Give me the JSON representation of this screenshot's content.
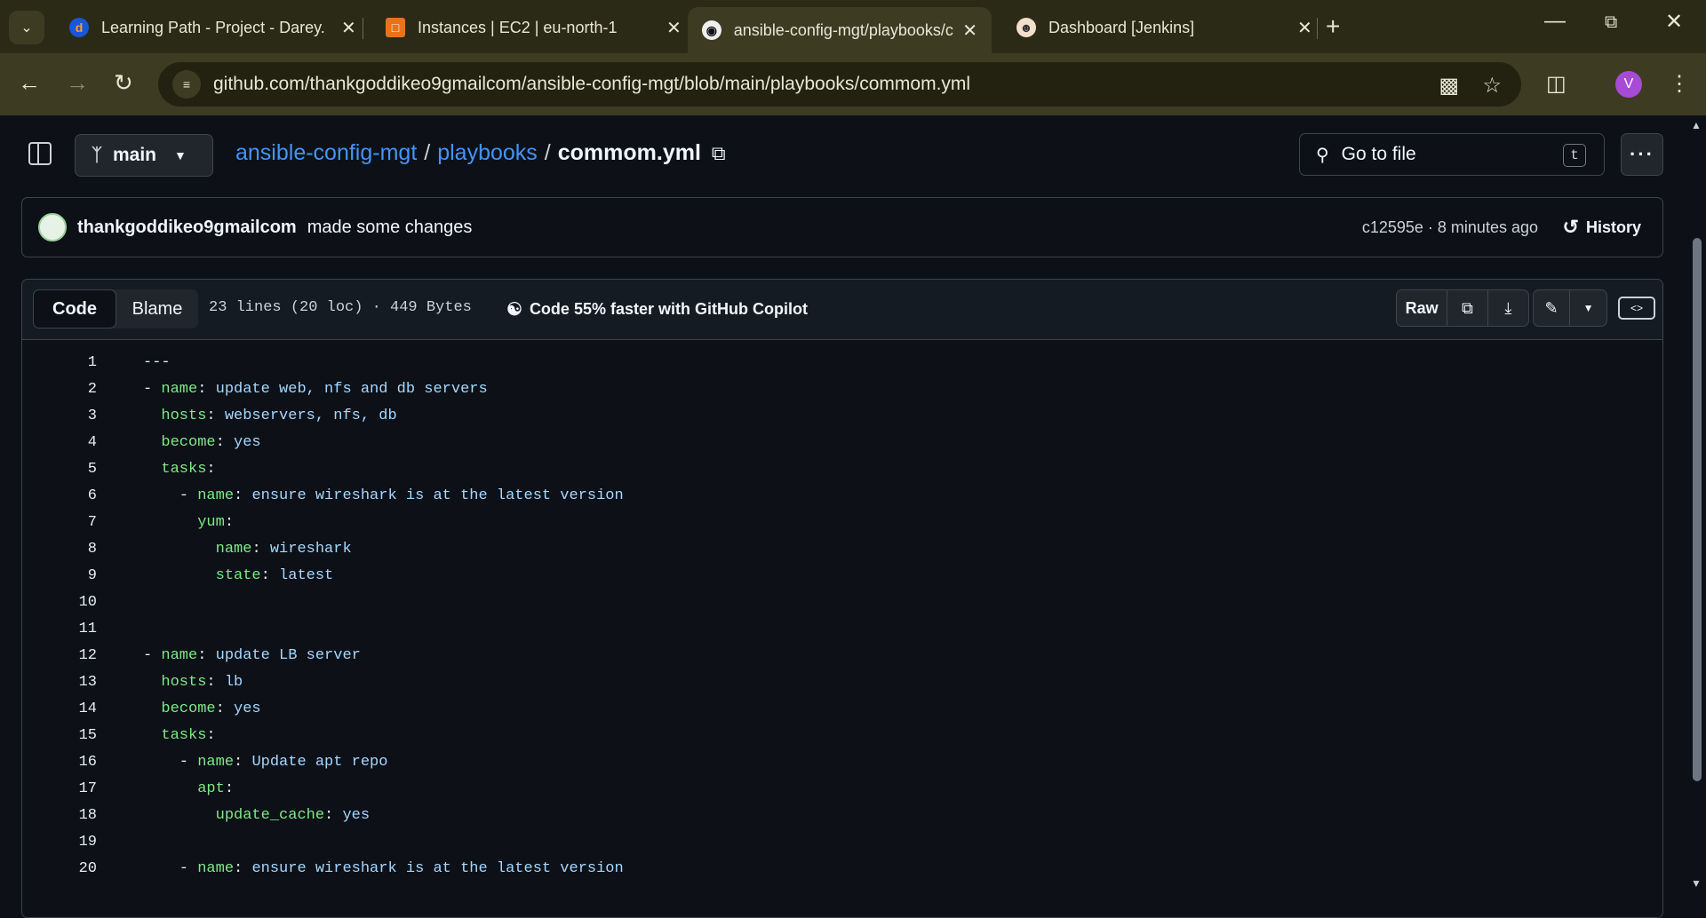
{
  "browser": {
    "tabs": [
      {
        "title": "Learning Path - Project - Darey.",
        "favicon": "darey-icon",
        "active": false
      },
      {
        "title": "Instances | EC2 | eu-north-1",
        "favicon": "aws-icon",
        "active": false
      },
      {
        "title": "ansible-config-mgt/playbooks/c",
        "favicon": "github-icon",
        "active": true
      },
      {
        "title": "Dashboard [Jenkins]",
        "favicon": "jenkins-icon",
        "active": false
      }
    ],
    "url": "github.com/thankgoddikeo9gmailcom/ansible-config-mgt/blob/main/playbooks/commom.yml",
    "profile_initial": "V"
  },
  "repo": {
    "branch": "main",
    "repo_name": "ansible-config-mgt",
    "folder": "playbooks",
    "file": "commom.yml",
    "goto_placeholder": "Go to file",
    "goto_shortcut": "t"
  },
  "commit": {
    "author": "thankgoddikeo9gmailcom",
    "message": "made some changes",
    "meta": "c12595e · 8 minutes ago",
    "history_label": "History"
  },
  "code_toolbar": {
    "code_tab": "Code",
    "blame_tab": "Blame",
    "lines_info": "23 lines (20 loc) · 449 Bytes",
    "copilot_label": "Code 55% faster with GitHub Copilot",
    "raw_label": "Raw"
  },
  "code_lines": [
    {
      "n": "1",
      "indent": "",
      "key": "",
      "value": "---"
    },
    {
      "n": "2",
      "indent": "- ",
      "key": "name",
      "value": "update web, nfs and db servers"
    },
    {
      "n": "3",
      "indent": "  ",
      "key": "hosts",
      "value": "webservers, nfs, db"
    },
    {
      "n": "4",
      "indent": "  ",
      "key": "become",
      "value": "yes"
    },
    {
      "n": "5",
      "indent": "  ",
      "key": "tasks",
      "value": ""
    },
    {
      "n": "6",
      "indent": "    - ",
      "key": "name",
      "value": "ensure wireshark is at the latest version"
    },
    {
      "n": "7",
      "indent": "      ",
      "key": "yum",
      "value": ""
    },
    {
      "n": "8",
      "indent": "        ",
      "key": "name",
      "value": "wireshark"
    },
    {
      "n": "9",
      "indent": "        ",
      "key": "state",
      "value": "latest"
    },
    {
      "n": "10",
      "indent": "",
      "key": "",
      "value": ""
    },
    {
      "n": "11",
      "indent": "",
      "key": "",
      "value": ""
    },
    {
      "n": "12",
      "indent": "- ",
      "key": "name",
      "value": "update LB server"
    },
    {
      "n": "13",
      "indent": "  ",
      "key": "hosts",
      "value": "lb"
    },
    {
      "n": "14",
      "indent": "  ",
      "key": "become",
      "value": "yes"
    },
    {
      "n": "15",
      "indent": "  ",
      "key": "tasks",
      "value": ""
    },
    {
      "n": "16",
      "indent": "    - ",
      "key": "name",
      "value": "Update apt repo"
    },
    {
      "n": "17",
      "indent": "      ",
      "key": "apt",
      "value": ""
    },
    {
      "n": "18",
      "indent": "        ",
      "key": "update_cache",
      "value": "yes"
    },
    {
      "n": "19",
      "indent": "",
      "key": "",
      "value": ""
    },
    {
      "n": "20",
      "indent": "    - ",
      "key": "name",
      "value": "ensure wireshark is at the latest version"
    }
  ]
}
